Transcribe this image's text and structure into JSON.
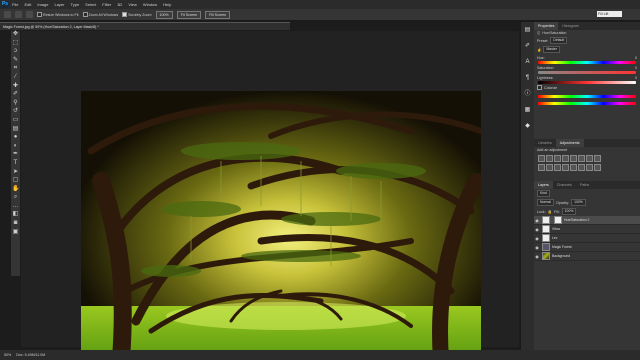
{
  "app": {
    "logo": "Ps"
  },
  "menu": [
    "File",
    "Edit",
    "Image",
    "Layer",
    "Type",
    "Select",
    "Filter",
    "3D",
    "View",
    "Window",
    "Help"
  ],
  "options": {
    "resize_windows": "Resize Windows to Fit",
    "zoom_all_windows": "Zoom All Windows",
    "scrubby_zoom": "Scrubby Zoom",
    "zoom_100": "100%",
    "fit_screen": "Fit Screen",
    "fill_screen": "Fill Screen",
    "workspace": "Fill Lift"
  },
  "document": {
    "tab_title": "Magic Forest.jpg @ 50% (Hue/Saturation 2, Layer Mask/8) *"
  },
  "status": {
    "zoom": "50%",
    "doc_size": "Doc: 5.49M/11.0M"
  },
  "properties": {
    "tabs": [
      "Properties",
      "Histogram"
    ],
    "panel_title": "Hue/Saturation",
    "preset_label": "Preset:",
    "preset_value": "Default",
    "channel_value": "Master",
    "hue_label": "Hue:",
    "hue_value": "0",
    "saturation_label": "Saturation:",
    "saturation_value": "0",
    "lightness_label": "Lightness:",
    "lightness_value": "0",
    "colorize_label": "Colorize"
  },
  "adjustments": {
    "tabs": [
      "Libraries",
      "Adjustments"
    ],
    "heading": "Add an adjustment"
  },
  "layers": {
    "tabs": [
      "Layers",
      "Channels",
      "Paths"
    ],
    "kind_label": "Kind",
    "blend_mode": "Normal",
    "opacity_label": "Opacity:",
    "opacity_value": "100%",
    "lock_label": "Lock:",
    "fill_label": "Fill:",
    "fill_value": "100%",
    "items": [
      {
        "name": "Hue/Saturation 2"
      },
      {
        "name": "Vibra"
      },
      {
        "name": "Lev"
      },
      {
        "name": "Magic Forest"
      },
      {
        "name": "Background"
      }
    ]
  }
}
